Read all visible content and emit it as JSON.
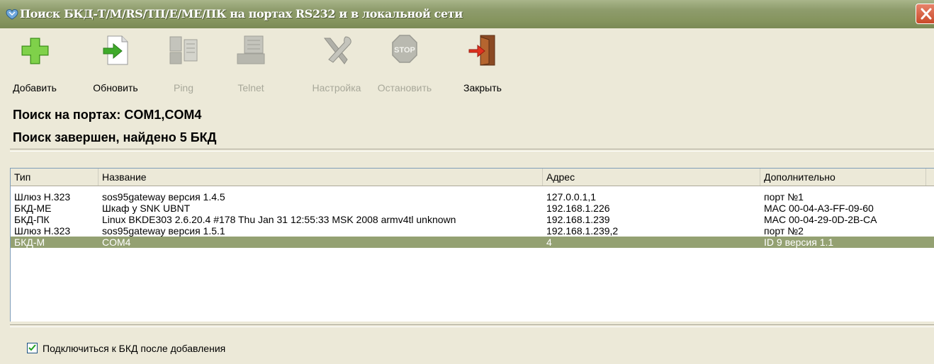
{
  "window": {
    "title": "Поиск БКД-Т/М/RS/ТП/Е/МЕ/ПК на портах RS232 и в локальной сети"
  },
  "toolbar": {
    "add_label": "Добавить",
    "refresh_label": "Обновить",
    "ping_label": "Ping",
    "telnet_label": "Telnet",
    "settings_label": "Настройка",
    "stop_label": "Остановить",
    "stop_icon_text": "STOP",
    "close_label": "Закрыть"
  },
  "status": {
    "ports_line": "Поиск на портах: COM1,COM4",
    "result_line": "Поиск завершен, найдено 5 БКД"
  },
  "devices_table": {
    "columns": [
      "Тип",
      "Название",
      "Адрес",
      "Дополнительно"
    ],
    "rows": [
      {
        "type": "Шлюз Н.323",
        "name": "sos95gateway версия 1.4.5",
        "address": "127.0.0.1,1",
        "extra": "порт №1",
        "selected": false
      },
      {
        "type": "БКД-МЕ",
        "name": "Шкаф у SNK UBNT",
        "address": "192.168.1.226",
        "extra": "MAC 00-04-A3-FF-09-60",
        "selected": false
      },
      {
        "type": "БКД-ПК",
        "name": "Linux BKDE303 2.6.20.4 #178 Thu Jan 31 12:55:33 MSK 2008 armv4tl unknown",
        "address": "192.168.1.239",
        "extra": "MAC 00-04-29-0D-2B-CA",
        "selected": false
      },
      {
        "type": "Шлюз Н.323",
        "name": "sos95gateway версия 1.5.1",
        "address": "192.168.1.239,2",
        "extra": "порт №2",
        "selected": false
      },
      {
        "type": "БКД-М",
        "name": "COM4",
        "address": "4",
        "extra": "ID 9 версия 1.1",
        "selected": true
      }
    ]
  },
  "options": {
    "connect_after_add_label": "Подключиться к БКД после добавления",
    "connect_after_add_checked": true
  },
  "colors": {
    "titlebar": "#8e9c6c",
    "selection": "#94a172",
    "close_button": "#c94a2a"
  }
}
